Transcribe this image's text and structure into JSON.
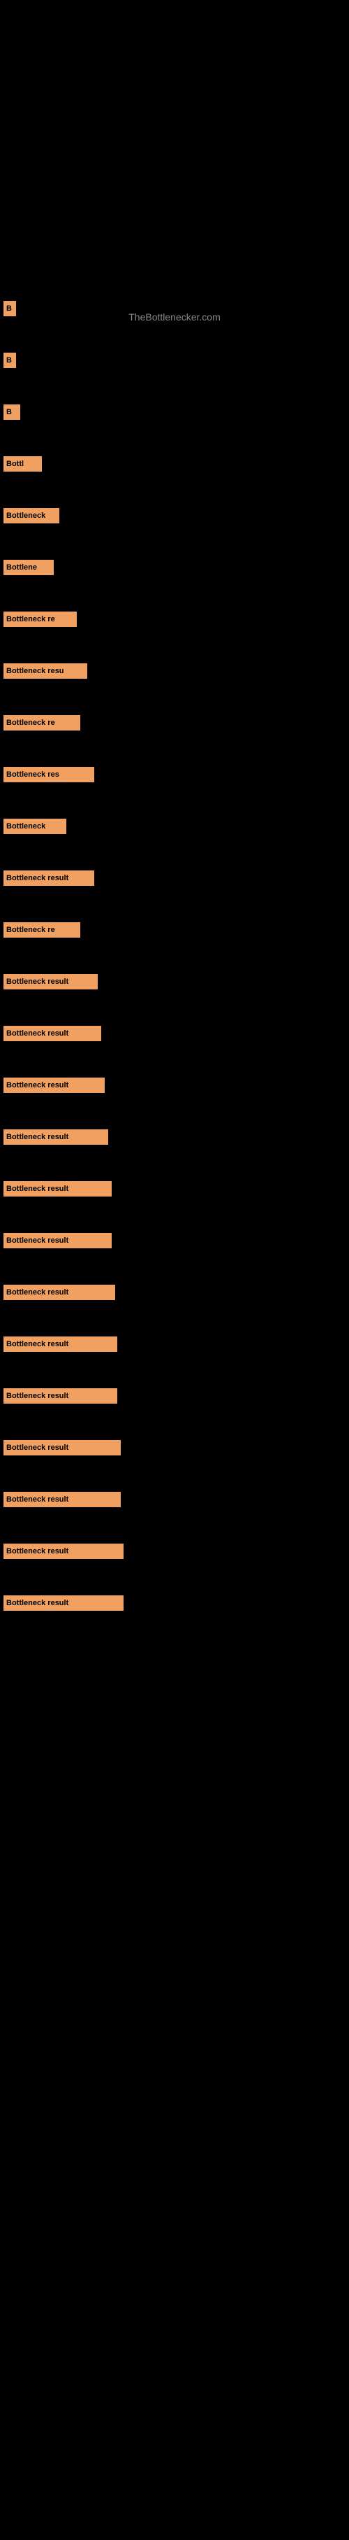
{
  "site": {
    "title": "TheBottlenecker.com"
  },
  "bars": [
    {
      "id": 1,
      "label": "B",
      "width": 18
    },
    {
      "id": 2,
      "label": "B",
      "width": 18
    },
    {
      "id": 3,
      "label": "B",
      "width": 24
    },
    {
      "id": 4,
      "label": "Bottl",
      "width": 55
    },
    {
      "id": 5,
      "label": "Bottleneck",
      "width": 80
    },
    {
      "id": 6,
      "label": "Bottlene",
      "width": 72
    },
    {
      "id": 7,
      "label": "Bottleneck re",
      "width": 105
    },
    {
      "id": 8,
      "label": "Bottleneck resu",
      "width": 120
    },
    {
      "id": 9,
      "label": "Bottleneck re",
      "width": 110
    },
    {
      "id": 10,
      "label": "Bottleneck res",
      "width": 130
    },
    {
      "id": 11,
      "label": "Bottleneck",
      "width": 90
    },
    {
      "id": 12,
      "label": "Bottleneck result",
      "width": 130
    },
    {
      "id": 13,
      "label": "Bottleneck re",
      "width": 110
    },
    {
      "id": 14,
      "label": "Bottleneck result",
      "width": 135
    },
    {
      "id": 15,
      "label": "Bottleneck result",
      "width": 140
    },
    {
      "id": 16,
      "label": "Bottleneck result",
      "width": 145
    },
    {
      "id": 17,
      "label": "Bottleneck result",
      "width": 150
    },
    {
      "id": 18,
      "label": "Bottleneck result",
      "width": 155
    },
    {
      "id": 19,
      "label": "Bottleneck result",
      "width": 155
    },
    {
      "id": 20,
      "label": "Bottleneck result",
      "width": 160
    },
    {
      "id": 21,
      "label": "Bottleneck result",
      "width": 163
    },
    {
      "id": 22,
      "label": "Bottleneck result",
      "width": 163
    },
    {
      "id": 23,
      "label": "Bottleneck result",
      "width": 168
    },
    {
      "id": 24,
      "label": "Bottleneck result",
      "width": 168
    },
    {
      "id": 25,
      "label": "Bottleneck result",
      "width": 172
    },
    {
      "id": 26,
      "label": "Bottleneck result",
      "width": 172
    }
  ],
  "colors": {
    "background": "#000000",
    "bar_fill": "#F0A060",
    "bar_text": "#000000",
    "site_title": "#888888"
  }
}
